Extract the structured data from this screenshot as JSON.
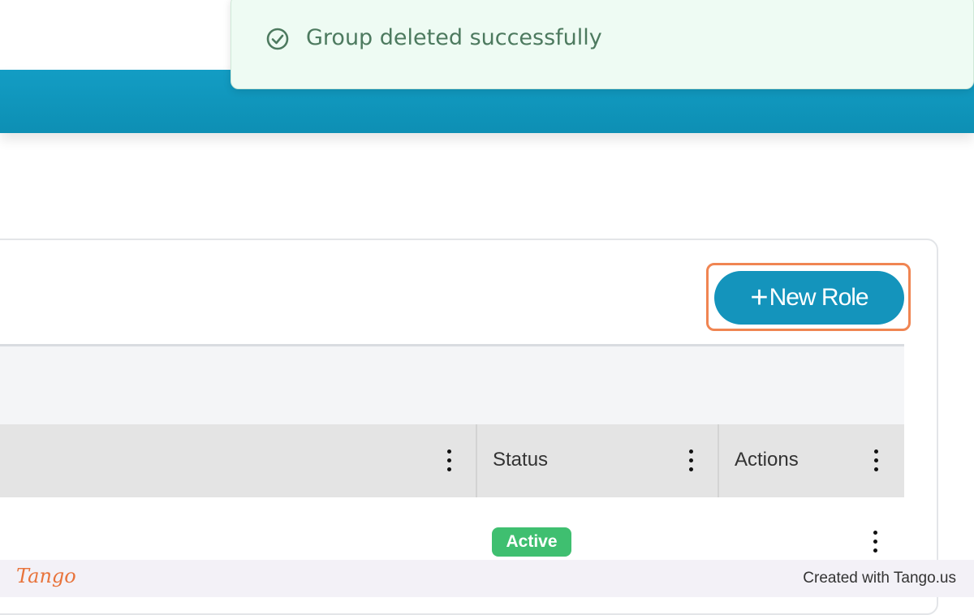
{
  "toast": {
    "message": "Group deleted successfully",
    "icon": "check-circle-icon"
  },
  "toolbar": {
    "new_role_label": "New Role",
    "new_role_icon": "plus-icon"
  },
  "table": {
    "columns": [
      {
        "label": ""
      },
      {
        "label": "Status"
      },
      {
        "label": "Actions"
      }
    ],
    "rows": [
      {
        "status": "Active"
      }
    ]
  },
  "footer": {
    "logo": "Tango",
    "credit": "Created with Tango.us"
  },
  "colors": {
    "header_blue": "#0d8fb4",
    "button_blue": "#1494bc",
    "highlight_orange": "#f08552",
    "toast_bg": "#eefbf3",
    "status_active": "#3fbf70"
  }
}
